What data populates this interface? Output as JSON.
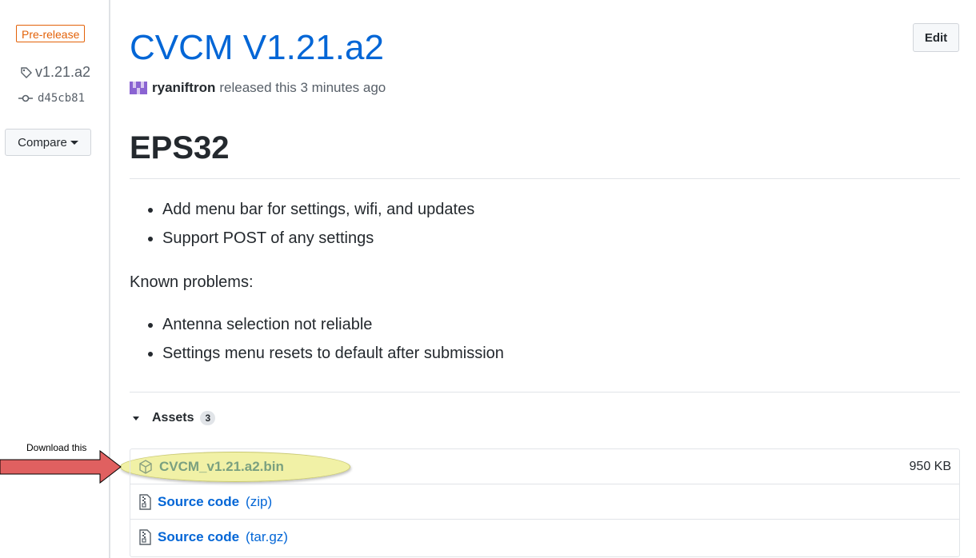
{
  "sidebar": {
    "badge": "Pre-release",
    "tag": "v1.21.a2",
    "commit": "d45cb81",
    "compare_label": "Compare"
  },
  "release": {
    "title": "CVCM V1.21.a2",
    "edit_label": "Edit",
    "author": "ryaniftron",
    "byline_suffix": "released this 3 minutes ago"
  },
  "body": {
    "heading": "EPS32",
    "features": [
      "Add menu bar for settings, wifi, and updates",
      "Support POST of any settings"
    ],
    "known_label": "Known problems:",
    "problems": [
      "Antenna selection not reliable",
      "Settings menu resets to default after submission"
    ]
  },
  "assets": {
    "label": "Assets",
    "count": "3",
    "items": [
      {
        "name": "CVCM_v1.21.a2.bin",
        "suffix": "",
        "size": "950 KB"
      },
      {
        "name": "Source code",
        "suffix": "(zip)",
        "size": ""
      },
      {
        "name": "Source code",
        "suffix": "(tar.gz)",
        "size": ""
      }
    ]
  },
  "annotation": {
    "text": "Download this"
  },
  "colors": {
    "link": "#0366d6",
    "prerelease": "#e36209",
    "highlight": "#eeee96",
    "arrow": "#e06060"
  }
}
